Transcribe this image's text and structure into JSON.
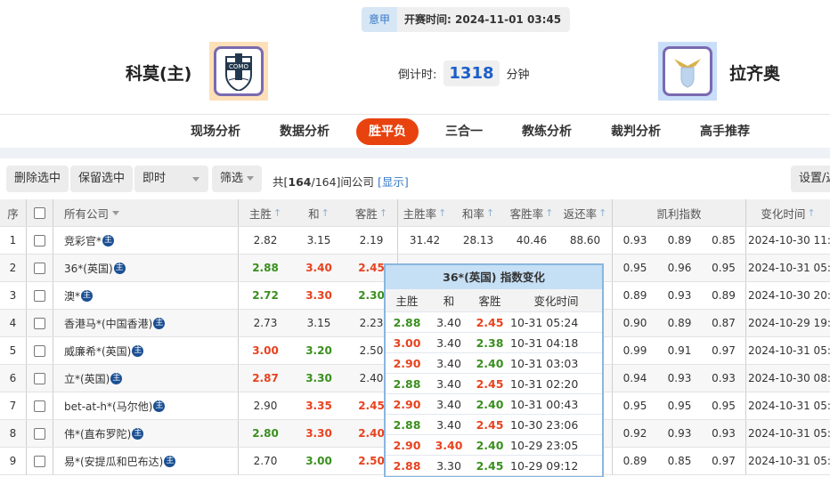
{
  "match": {
    "league": "意甲",
    "kickoff_label": "开赛时间:",
    "kickoff": "2024-11-01 03:45",
    "home": "科莫(主)",
    "away": "拉齐奥",
    "countdown_label": "倒计时:",
    "countdown": "1318",
    "countdown_unit": "分钟",
    "home_logo_text": "COMO",
    "home_logo_bg": "#fde0b8",
    "away_logo_bg": "#c9def8"
  },
  "nav": [
    {
      "label": "现场分析"
    },
    {
      "label": "数据分析"
    },
    {
      "label": "胜平负",
      "active": true
    },
    {
      "label": "三合一"
    },
    {
      "label": "教练分析"
    },
    {
      "label": "裁判分析"
    },
    {
      "label": "高手推荐"
    }
  ],
  "toolbar": {
    "delete": "删除选中",
    "keep": "保留选中",
    "mode": "即时",
    "filter": "筛选",
    "count_prefix": "共[",
    "count_bold": "164",
    "count_rest": "/164]间公司",
    "show": "[显示]",
    "settings": "设置/返"
  },
  "headers": {
    "seq": "序",
    "company": "所有公司",
    "home": "主胜",
    "draw": "和",
    "away": "客胜",
    "home_rate": "主胜率",
    "draw_rate": "和率",
    "away_rate": "客胜率",
    "return_rate": "返还率",
    "kelly": "凯利指数",
    "time": "变化时间",
    "arrow": "↑"
  },
  "colors": {
    "up": "#e8421e",
    "down": "#3a8f1e",
    "accent": "#e8430f"
  },
  "rows": [
    {
      "seq": "1",
      "company": "竞彩官*",
      "badge": "主",
      "odds": [
        {
          "v": "2.82",
          "c": ""
        },
        {
          "v": "3.15",
          "c": ""
        },
        {
          "v": "2.19",
          "c": ""
        }
      ],
      "rates": [
        "31.42",
        "28.13",
        "40.46",
        "88.60"
      ],
      "kelly": [
        "0.93",
        "0.89",
        "0.85"
      ],
      "time": "2024-10-30 11:02"
    },
    {
      "seq": "2",
      "company": "36*(英国)",
      "badge": "主",
      "odds": [
        {
          "v": "2.88",
          "c": "down"
        },
        {
          "v": "3.40",
          "c": "up"
        },
        {
          "v": "2.45",
          "c": "up"
        }
      ],
      "rates": [
        "",
        "",
        "",
        ""
      ],
      "kelly": [
        "0.95",
        "0.96",
        "0.95"
      ],
      "time": "2024-10-31 05:25"
    },
    {
      "seq": "3",
      "company": "澳*",
      "badge": "主",
      "odds": [
        {
          "v": "2.72",
          "c": "down"
        },
        {
          "v": "3.30",
          "c": "up"
        },
        {
          "v": "2.30",
          "c": "down"
        }
      ],
      "rates": [
        "",
        "",
        "",
        ""
      ],
      "kelly": [
        "0.89",
        "0.93",
        "0.89"
      ],
      "time": "2024-10-30 20:25"
    },
    {
      "seq": "4",
      "company": "香港马*(中国香港)",
      "badge": "主",
      "odds": [
        {
          "v": "2.73",
          "c": ""
        },
        {
          "v": "3.15",
          "c": ""
        },
        {
          "v": "2.23",
          "c": ""
        }
      ],
      "rates": [
        "",
        "",
        "",
        ""
      ],
      "kelly": [
        "0.90",
        "0.89",
        "0.87"
      ],
      "time": "2024-10-29 19:32"
    },
    {
      "seq": "5",
      "company": "威廉希*(英国)",
      "badge": "主",
      "odds": [
        {
          "v": "3.00",
          "c": "up"
        },
        {
          "v": "3.20",
          "c": "down"
        },
        {
          "v": "2.50",
          "c": ""
        }
      ],
      "rates": [
        "",
        "",
        "",
        ""
      ],
      "kelly": [
        "0.99",
        "0.91",
        "0.97"
      ],
      "time": "2024-10-31 05:44"
    },
    {
      "seq": "6",
      "company": "立*(英国)",
      "badge": "主",
      "odds": [
        {
          "v": "2.87",
          "c": "up"
        },
        {
          "v": "3.30",
          "c": "down"
        },
        {
          "v": "2.40",
          "c": ""
        }
      ],
      "rates": [
        "",
        "",
        "",
        ""
      ],
      "kelly": [
        "0.94",
        "0.93",
        "0.93"
      ],
      "time": "2024-10-30 08:15"
    },
    {
      "seq": "7",
      "company": "bet-at-h*(马尔他)",
      "badge": "主",
      "odds": [
        {
          "v": "2.90",
          "c": ""
        },
        {
          "v": "3.35",
          "c": "up"
        },
        {
          "v": "2.45",
          "c": "up"
        }
      ],
      "rates": [
        "",
        "",
        "",
        ""
      ],
      "kelly": [
        "0.95",
        "0.95",
        "0.95"
      ],
      "time": "2024-10-31 05:31"
    },
    {
      "seq": "8",
      "company": "伟*(直布罗陀)",
      "badge": "主",
      "odds": [
        {
          "v": "2.80",
          "c": "down"
        },
        {
          "v": "3.30",
          "c": "up"
        },
        {
          "v": "2.40",
          "c": "up"
        }
      ],
      "rates": [
        "",
        "",
        "",
        ""
      ],
      "kelly": [
        "0.92",
        "0.93",
        "0.93"
      ],
      "time": "2024-10-31 05:34"
    },
    {
      "seq": "9",
      "company": "易*(安提瓜和巴布达)",
      "badge": "主",
      "odds": [
        {
          "v": "2.70",
          "c": ""
        },
        {
          "v": "3.00",
          "c": "down"
        },
        {
          "v": "2.50",
          "c": "up"
        }
      ],
      "rates": [
        "",
        "",
        "",
        ""
      ],
      "kelly": [
        "0.89",
        "0.85",
        "0.97"
      ],
      "time": "2024-10-31 05:39"
    }
  ],
  "popup": {
    "title": "36*(英国) 指数变化",
    "headers": [
      "主胜",
      "和",
      "客胜",
      "变化时间"
    ],
    "rows": [
      [
        {
          "v": "2.88",
          "c": "down"
        },
        {
          "v": "3.40",
          "c": ""
        },
        {
          "v": "2.45",
          "c": "up"
        },
        "10-31 05:24"
      ],
      [
        {
          "v": "3.00",
          "c": "up"
        },
        {
          "v": "3.40",
          "c": ""
        },
        {
          "v": "2.38",
          "c": "down"
        },
        "10-31 04:18"
      ],
      [
        {
          "v": "2.90",
          "c": "up"
        },
        {
          "v": "3.40",
          "c": ""
        },
        {
          "v": "2.40",
          "c": "down"
        },
        "10-31 03:03"
      ],
      [
        {
          "v": "2.88",
          "c": "down"
        },
        {
          "v": "3.40",
          "c": ""
        },
        {
          "v": "2.45",
          "c": "up"
        },
        "10-31 02:20"
      ],
      [
        {
          "v": "2.90",
          "c": "up"
        },
        {
          "v": "3.40",
          "c": ""
        },
        {
          "v": "2.40",
          "c": "down"
        },
        "10-31 00:43"
      ],
      [
        {
          "v": "2.88",
          "c": "down"
        },
        {
          "v": "3.40",
          "c": ""
        },
        {
          "v": "2.45",
          "c": "up"
        },
        "10-30 23:06"
      ],
      [
        {
          "v": "2.90",
          "c": "up"
        },
        {
          "v": "3.40",
          "c": "up"
        },
        {
          "v": "2.40",
          "c": "down"
        },
        "10-29 23:05"
      ],
      [
        {
          "v": "2.88",
          "c": "up"
        },
        {
          "v": "3.30",
          "c": ""
        },
        {
          "v": "2.45",
          "c": "down"
        },
        "10-29 09:12"
      ]
    ]
  }
}
